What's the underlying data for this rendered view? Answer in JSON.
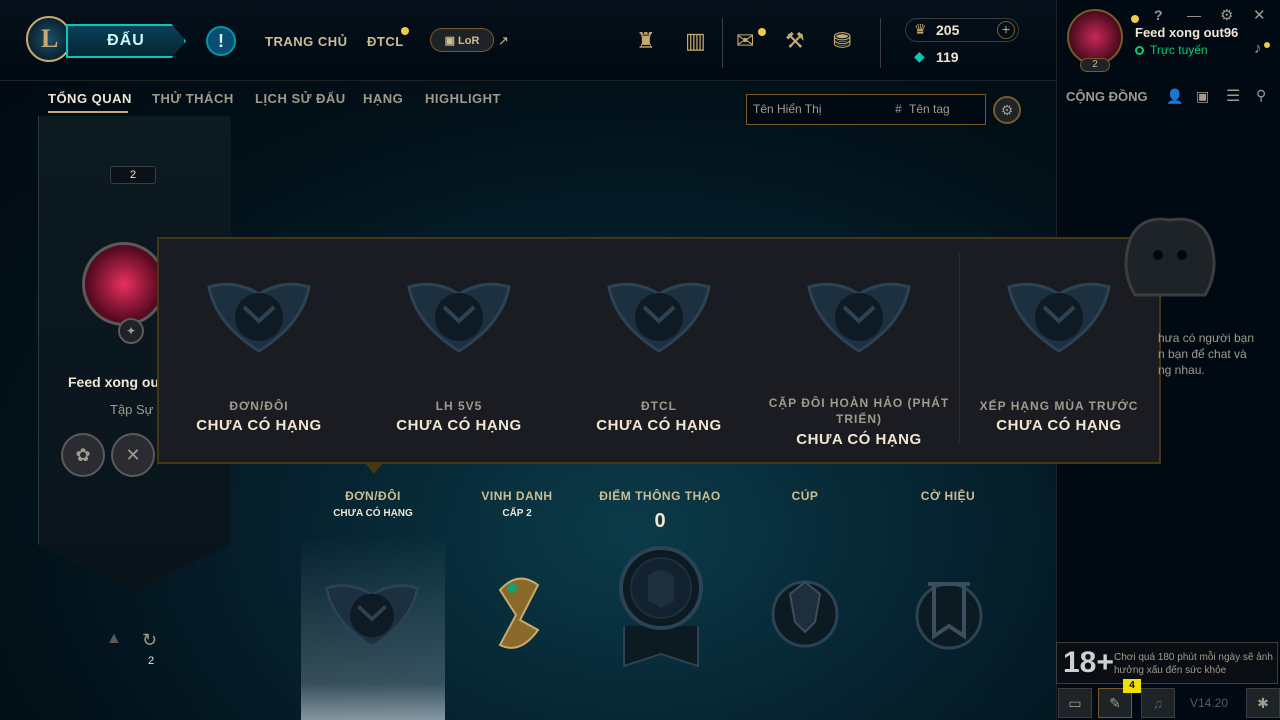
{
  "header": {
    "logo": "L",
    "play_label": "ĐẤU",
    "alert_icon": "!",
    "nav": [
      {
        "label": "TRANG CHỦ"
      },
      {
        "label": "ĐTCL"
      }
    ],
    "lor_label": "LoR",
    "external_icon": "↗",
    "rp": "205",
    "be": "119"
  },
  "profile": {
    "name": "Feed xong out96",
    "status": "Trực tuyến",
    "level": "2"
  },
  "window_controls": {
    "help": "?",
    "minimize": "—",
    "settings": "⚙",
    "close": "✕"
  },
  "subnav": {
    "items": [
      "TỔNG QUAN",
      "THỬ THÁCH",
      "LỊCH SỬ ĐẤU",
      "HẠNG",
      "HIGHLIGHT"
    ]
  },
  "search": {
    "name_placeholder": "Tên Hiển Thị",
    "tag_placeholder": "Tên tag",
    "hash": "#"
  },
  "banner": {
    "level_badge": "2",
    "name": "Feed xong ou",
    "subtitle": "Tập Sự",
    "refresh_count": "2"
  },
  "ranked_popup": {
    "items": [
      {
        "queue": "ĐƠN/ĐÔI",
        "tier": "CHƯA CÓ HẠNG"
      },
      {
        "queue": "LH 5V5",
        "tier": "CHƯA CÓ HẠNG"
      },
      {
        "queue": "ĐTCL",
        "tier": "CHƯA CÓ HẠNG"
      },
      {
        "queue": "CẶP ĐÔI HOÀN HẢO (PHÁT TRIỂN)",
        "tier": "CHƯA CÓ HẠNG"
      },
      {
        "queue": "XẾP HẠNG MÙA TRƯỚC",
        "tier": "CHƯA CÓ HẠNG"
      }
    ]
  },
  "overview_columns": [
    {
      "title": "ĐƠN/ĐÔI",
      "sub": "CHƯA CÓ HẠNG"
    },
    {
      "title": "VINH DANH",
      "sub": "CẤP 2"
    },
    {
      "title": "ĐIỂM THÔNG THẠO",
      "sub": "0"
    },
    {
      "title": "CÚP",
      "sub": ""
    },
    {
      "title": "CỜ HIỆU",
      "sub": ""
    }
  ],
  "social": {
    "title": "CỘNG ĐỒNG",
    "empty_text": [
      "hưa có người bạn",
      "n bạn để chat và",
      "ng nhau."
    ]
  },
  "notice": {
    "rating": "18+",
    "text": "Chơi quá 180 phút mỗi ngày sẽ ảnh hưởng xấu đến sức khỏe"
  },
  "footer": {
    "badge_count": "4",
    "version": "V14.20"
  },
  "colors": {
    "gold": "#c8aa6e",
    "teal": "#0ac8b9",
    "bg": "#010a13",
    "online": "#0acb72"
  }
}
